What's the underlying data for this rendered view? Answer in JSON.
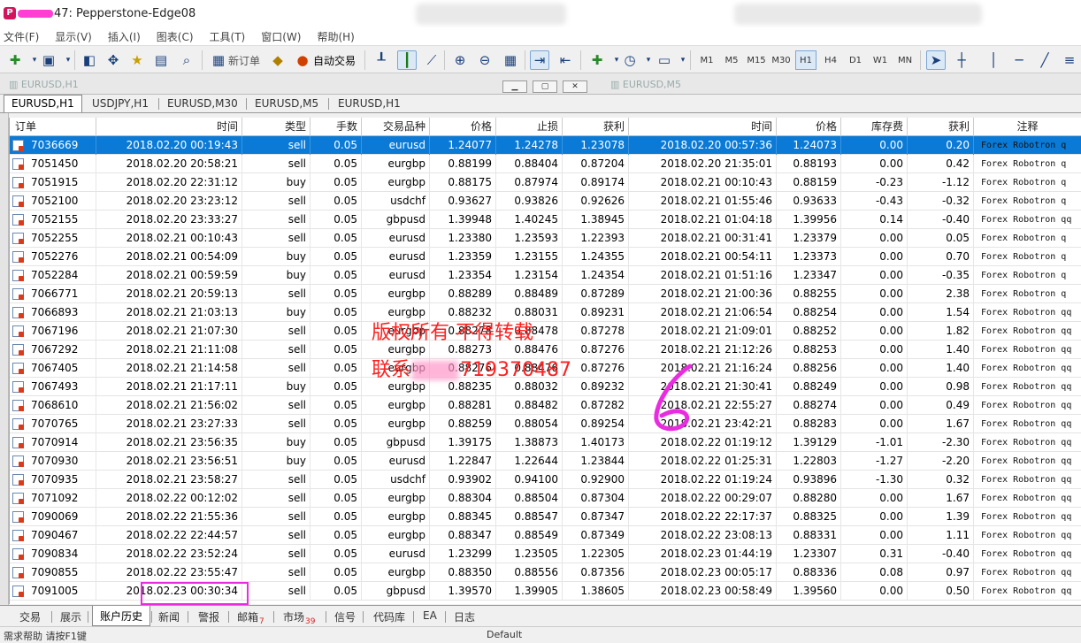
{
  "window": {
    "title": "47: Pepperstone-Edge08"
  },
  "menu": [
    "文件(F)",
    "显示(V)",
    "插入(I)",
    "图表(C)",
    "工具(T)",
    "窗口(W)",
    "帮助(H)"
  ],
  "toolbar": {
    "new_order_label": "新订单",
    "auto_trade_label": "自动交易",
    "periods": [
      "M1",
      "M5",
      "M15",
      "M30",
      "H1",
      "H4",
      "D1",
      "W1",
      "MN"
    ],
    "active_period": "H1"
  },
  "chart_windows": [
    "EURUSD,H1",
    "EURUSD,M5"
  ],
  "chart_tabs": [
    "EURUSD,H1",
    "USDJPY,H1",
    "EURUSD,M30",
    "EURUSD,M5",
    "EURUSD,H1"
  ],
  "columns": [
    "订单",
    "时间",
    "类型",
    "手数",
    "交易品种",
    "价格",
    "止损",
    "获利",
    "时间",
    "价格",
    "库存费",
    "获利",
    "注释"
  ],
  "rows": [
    [
      "7036669",
      "2018.02.20 00:19:43",
      "sell",
      "0.05",
      "eurusd",
      "1.24077",
      "1.24278",
      "1.23078",
      "2018.02.20 00:57:36",
      "1.24073",
      "0.00",
      "0.20",
      "Forex Robotron q"
    ],
    [
      "7051450",
      "2018.02.20 20:58:21",
      "sell",
      "0.05",
      "eurgbp",
      "0.88199",
      "0.88404",
      "0.87204",
      "2018.02.20 21:35:01",
      "0.88193",
      "0.00",
      "0.42",
      "Forex Robotron q"
    ],
    [
      "7051915",
      "2018.02.20 22:31:12",
      "buy",
      "0.05",
      "eurgbp",
      "0.88175",
      "0.87974",
      "0.89174",
      "2018.02.21 00:10:43",
      "0.88159",
      "-0.23",
      "-1.12",
      "Forex Robotron q"
    ],
    [
      "7052100",
      "2018.02.20 23:23:12",
      "sell",
      "0.05",
      "usdchf",
      "0.93627",
      "0.93826",
      "0.92626",
      "2018.02.21 01:55:46",
      "0.93633",
      "-0.43",
      "-0.32",
      "Forex Robotron q"
    ],
    [
      "7052155",
      "2018.02.20 23:33:27",
      "sell",
      "0.05",
      "gbpusd",
      "1.39948",
      "1.40245",
      "1.38945",
      "2018.02.21 01:04:18",
      "1.39956",
      "0.14",
      "-0.40",
      "Forex Robotron qq"
    ],
    [
      "7052255",
      "2018.02.21 00:10:43",
      "sell",
      "0.05",
      "eurusd",
      "1.23380",
      "1.23593",
      "1.22393",
      "2018.02.21 00:31:41",
      "1.23379",
      "0.00",
      "0.05",
      "Forex Robotron q"
    ],
    [
      "7052276",
      "2018.02.21 00:54:09",
      "buy",
      "0.05",
      "eurusd",
      "1.23359",
      "1.23155",
      "1.24355",
      "2018.02.21 00:54:11",
      "1.23373",
      "0.00",
      "0.70",
      "Forex Robotron q"
    ],
    [
      "7052284",
      "2018.02.21 00:59:59",
      "buy",
      "0.05",
      "eurusd",
      "1.23354",
      "1.23154",
      "1.24354",
      "2018.02.21 01:51:16",
      "1.23347",
      "0.00",
      "-0.35",
      "Forex Robotron q"
    ],
    [
      "7066771",
      "2018.02.21 20:59:13",
      "sell",
      "0.05",
      "eurgbp",
      "0.88289",
      "0.88489",
      "0.87289",
      "2018.02.21 21:00:36",
      "0.88255",
      "0.00",
      "2.38",
      "Forex Robotron q"
    ],
    [
      "7066893",
      "2018.02.21 21:03:13",
      "buy",
      "0.05",
      "eurgbp",
      "0.88232",
      "0.88031",
      "0.89231",
      "2018.02.21 21:06:54",
      "0.88254",
      "0.00",
      "1.54",
      "Forex Robotron qq"
    ],
    [
      "7067196",
      "2018.02.21 21:07:30",
      "sell",
      "0.05",
      "eurgbp",
      "0.88278",
      "0.88478",
      "0.87278",
      "2018.02.21 21:09:01",
      "0.88252",
      "0.00",
      "1.82",
      "Forex Robotron qq"
    ],
    [
      "7067292",
      "2018.02.21 21:11:08",
      "sell",
      "0.05",
      "eurgbp",
      "0.88273",
      "0.88476",
      "0.87276",
      "2018.02.21 21:12:26",
      "0.88253",
      "0.00",
      "1.40",
      "Forex Robotron qq"
    ],
    [
      "7067405",
      "2018.02.21 21:14:58",
      "sell",
      "0.05",
      "eurgbp",
      "0.88276",
      "0.88476",
      "0.87276",
      "2018.02.21 21:16:24",
      "0.88256",
      "0.00",
      "1.40",
      "Forex Robotron qq"
    ],
    [
      "7067493",
      "2018.02.21 21:17:11",
      "buy",
      "0.05",
      "eurgbp",
      "0.88235",
      "0.88032",
      "0.89232",
      "2018.02.21 21:30:41",
      "0.88249",
      "0.00",
      "0.98",
      "Forex Robotron qq"
    ],
    [
      "7068610",
      "2018.02.21 21:56:02",
      "sell",
      "0.05",
      "eurgbp",
      "0.88281",
      "0.88482",
      "0.87282",
      "2018.02.21 22:55:27",
      "0.88274",
      "0.00",
      "0.49",
      "Forex Robotron qq"
    ],
    [
      "7070765",
      "2018.02.21 23:27:33",
      "sell",
      "0.05",
      "eurgbp",
      "0.88259",
      "0.88054",
      "0.89254",
      "2018.02.21 23:42:21",
      "0.88283",
      "0.00",
      "1.67",
      "Forex Robotron qq"
    ],
    [
      "7070914",
      "2018.02.21 23:56:35",
      "buy",
      "0.05",
      "gbpusd",
      "1.39175",
      "1.38873",
      "1.40173",
      "2018.02.22 01:19:12",
      "1.39129",
      "-1.01",
      "-2.30",
      "Forex Robotron qq"
    ],
    [
      "7070930",
      "2018.02.21 23:56:51",
      "buy",
      "0.05",
      "eurusd",
      "1.22847",
      "1.22644",
      "1.23844",
      "2018.02.22 01:25:31",
      "1.22803",
      "-1.27",
      "-2.20",
      "Forex Robotron qq"
    ],
    [
      "7070935",
      "2018.02.21 23:58:27",
      "sell",
      "0.05",
      "usdchf",
      "0.93902",
      "0.94100",
      "0.92900",
      "2018.02.22 01:19:24",
      "0.93896",
      "-1.30",
      "0.32",
      "Forex Robotron qq"
    ],
    [
      "7071092",
      "2018.02.22 00:12:02",
      "sell",
      "0.05",
      "eurgbp",
      "0.88304",
      "0.88504",
      "0.87304",
      "2018.02.22 00:29:07",
      "0.88280",
      "0.00",
      "1.67",
      "Forex Robotron qq"
    ],
    [
      "7090069",
      "2018.02.22 21:55:36",
      "sell",
      "0.05",
      "eurgbp",
      "0.88345",
      "0.88547",
      "0.87347",
      "2018.02.22 22:17:37",
      "0.88325",
      "0.00",
      "1.39",
      "Forex Robotron qq"
    ],
    [
      "7090467",
      "2018.02.22 22:44:57",
      "sell",
      "0.05",
      "eurgbp",
      "0.88347",
      "0.88549",
      "0.87349",
      "2018.02.22 23:08:13",
      "0.88331",
      "0.00",
      "1.11",
      "Forex Robotron qq"
    ],
    [
      "7090834",
      "2018.02.22 23:52:24",
      "sell",
      "0.05",
      "eurusd",
      "1.23299",
      "1.23505",
      "1.22305",
      "2018.02.23 01:44:19",
      "1.23307",
      "0.31",
      "-0.40",
      "Forex Robotron qq"
    ],
    [
      "7090855",
      "2018.02.22 23:55:47",
      "sell",
      "0.05",
      "eurgbp",
      "0.88350",
      "0.88556",
      "0.87356",
      "2018.02.23 00:05:17",
      "0.88336",
      "0.08",
      "0.97",
      "Forex Robotron qq"
    ],
    [
      "7091005",
      "2018.02.23 00:30:34",
      "sell",
      "0.05",
      "gbpusd",
      "1.39570",
      "1.39905",
      "1.38605",
      "2018.02.23 00:58:49",
      "1.39560",
      "0.00",
      "0.50",
      "Forex Robotron qq"
    ]
  ],
  "watermark": {
    "line1": "版权所有 不得转载",
    "line2_prefix": "联系",
    "line2_suffix": "719370487",
    "mark": "6"
  },
  "bottom_tabs": [
    {
      "label": "交易"
    },
    {
      "label": "展示"
    },
    {
      "label": "账户历史",
      "active": true
    },
    {
      "label": "新闻"
    },
    {
      "label": "警报"
    },
    {
      "label": "邮箱",
      "badge": "7"
    },
    {
      "label": "市场",
      "badge": "39"
    },
    {
      "label": "信号"
    },
    {
      "label": "代码库"
    },
    {
      "label": "EA"
    },
    {
      "label": "日志"
    }
  ],
  "status": {
    "left": "需求帮助 请按F1键",
    "profile": "Default"
  },
  "colors": {
    "selected_row": "#0a7ad6",
    "watermark": "#ff2020",
    "highlight_box": "#ea2ce0"
  }
}
